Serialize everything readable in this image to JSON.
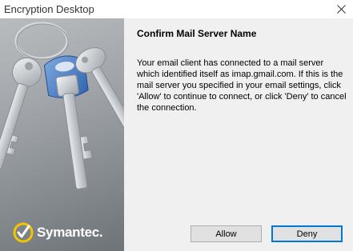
{
  "window": {
    "title": "Encryption Desktop"
  },
  "side_panel": {
    "brand_name": "Symantec."
  },
  "dialog": {
    "heading": "Confirm Mail Server Name",
    "message": "Your email client has connected to a mail server which identified itself as imap.gmail.com.  If this is the mail server you specified in your email settings, click 'Allow' to continue to connect, or click 'Deny' to cancel the connection."
  },
  "buttons": {
    "allow_label": "Allow",
    "deny_label": "Deny"
  },
  "icons": {
    "close": "close-icon",
    "keys": "keys-illustration",
    "brand": "symantec-logo-icon"
  },
  "colors": {
    "side_panel": "#9a9ea2",
    "brand_yellow": "#f5c400",
    "key_blue": "#3c78c8",
    "focus_border": "#0078d7"
  }
}
